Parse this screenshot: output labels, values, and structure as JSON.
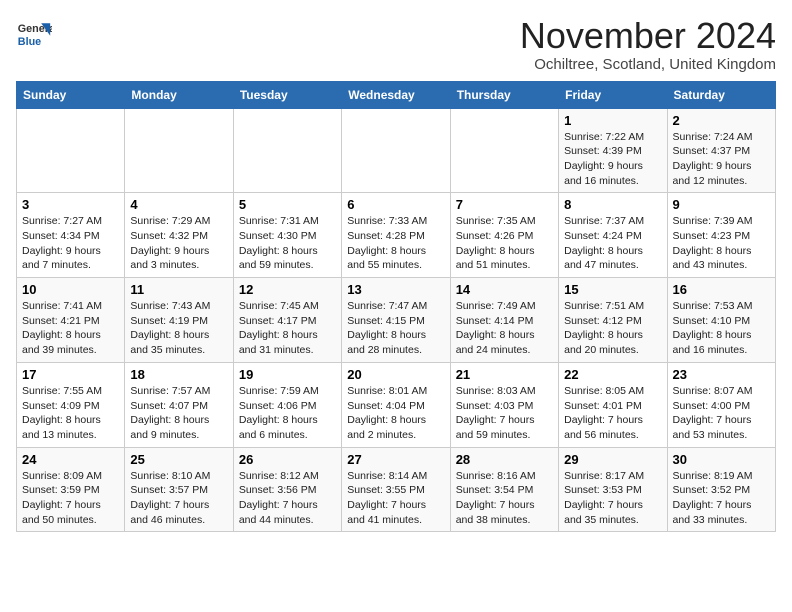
{
  "logo": {
    "text_general": "General",
    "text_blue": "Blue"
  },
  "header": {
    "month_title": "November 2024",
    "location": "Ochiltree, Scotland, United Kingdom"
  },
  "days_of_week": [
    "Sunday",
    "Monday",
    "Tuesday",
    "Wednesday",
    "Thursday",
    "Friday",
    "Saturday"
  ],
  "weeks": [
    [
      {
        "day": "",
        "info": ""
      },
      {
        "day": "",
        "info": ""
      },
      {
        "day": "",
        "info": ""
      },
      {
        "day": "",
        "info": ""
      },
      {
        "day": "",
        "info": ""
      },
      {
        "day": "1",
        "info": "Sunrise: 7:22 AM\nSunset: 4:39 PM\nDaylight: 9 hours and 16 minutes."
      },
      {
        "day": "2",
        "info": "Sunrise: 7:24 AM\nSunset: 4:37 PM\nDaylight: 9 hours and 12 minutes."
      }
    ],
    [
      {
        "day": "3",
        "info": "Sunrise: 7:27 AM\nSunset: 4:34 PM\nDaylight: 9 hours and 7 minutes."
      },
      {
        "day": "4",
        "info": "Sunrise: 7:29 AM\nSunset: 4:32 PM\nDaylight: 9 hours and 3 minutes."
      },
      {
        "day": "5",
        "info": "Sunrise: 7:31 AM\nSunset: 4:30 PM\nDaylight: 8 hours and 59 minutes."
      },
      {
        "day": "6",
        "info": "Sunrise: 7:33 AM\nSunset: 4:28 PM\nDaylight: 8 hours and 55 minutes."
      },
      {
        "day": "7",
        "info": "Sunrise: 7:35 AM\nSunset: 4:26 PM\nDaylight: 8 hours and 51 minutes."
      },
      {
        "day": "8",
        "info": "Sunrise: 7:37 AM\nSunset: 4:24 PM\nDaylight: 8 hours and 47 minutes."
      },
      {
        "day": "9",
        "info": "Sunrise: 7:39 AM\nSunset: 4:23 PM\nDaylight: 8 hours and 43 minutes."
      }
    ],
    [
      {
        "day": "10",
        "info": "Sunrise: 7:41 AM\nSunset: 4:21 PM\nDaylight: 8 hours and 39 minutes."
      },
      {
        "day": "11",
        "info": "Sunrise: 7:43 AM\nSunset: 4:19 PM\nDaylight: 8 hours and 35 minutes."
      },
      {
        "day": "12",
        "info": "Sunrise: 7:45 AM\nSunset: 4:17 PM\nDaylight: 8 hours and 31 minutes."
      },
      {
        "day": "13",
        "info": "Sunrise: 7:47 AM\nSunset: 4:15 PM\nDaylight: 8 hours and 28 minutes."
      },
      {
        "day": "14",
        "info": "Sunrise: 7:49 AM\nSunset: 4:14 PM\nDaylight: 8 hours and 24 minutes."
      },
      {
        "day": "15",
        "info": "Sunrise: 7:51 AM\nSunset: 4:12 PM\nDaylight: 8 hours and 20 minutes."
      },
      {
        "day": "16",
        "info": "Sunrise: 7:53 AM\nSunset: 4:10 PM\nDaylight: 8 hours and 16 minutes."
      }
    ],
    [
      {
        "day": "17",
        "info": "Sunrise: 7:55 AM\nSunset: 4:09 PM\nDaylight: 8 hours and 13 minutes."
      },
      {
        "day": "18",
        "info": "Sunrise: 7:57 AM\nSunset: 4:07 PM\nDaylight: 8 hours and 9 minutes."
      },
      {
        "day": "19",
        "info": "Sunrise: 7:59 AM\nSunset: 4:06 PM\nDaylight: 8 hours and 6 minutes."
      },
      {
        "day": "20",
        "info": "Sunrise: 8:01 AM\nSunset: 4:04 PM\nDaylight: 8 hours and 2 minutes."
      },
      {
        "day": "21",
        "info": "Sunrise: 8:03 AM\nSunset: 4:03 PM\nDaylight: 7 hours and 59 minutes."
      },
      {
        "day": "22",
        "info": "Sunrise: 8:05 AM\nSunset: 4:01 PM\nDaylight: 7 hours and 56 minutes."
      },
      {
        "day": "23",
        "info": "Sunrise: 8:07 AM\nSunset: 4:00 PM\nDaylight: 7 hours and 53 minutes."
      }
    ],
    [
      {
        "day": "24",
        "info": "Sunrise: 8:09 AM\nSunset: 3:59 PM\nDaylight: 7 hours and 50 minutes."
      },
      {
        "day": "25",
        "info": "Sunrise: 8:10 AM\nSunset: 3:57 PM\nDaylight: 7 hours and 46 minutes."
      },
      {
        "day": "26",
        "info": "Sunrise: 8:12 AM\nSunset: 3:56 PM\nDaylight: 7 hours and 44 minutes."
      },
      {
        "day": "27",
        "info": "Sunrise: 8:14 AM\nSunset: 3:55 PM\nDaylight: 7 hours and 41 minutes."
      },
      {
        "day": "28",
        "info": "Sunrise: 8:16 AM\nSunset: 3:54 PM\nDaylight: 7 hours and 38 minutes."
      },
      {
        "day": "29",
        "info": "Sunrise: 8:17 AM\nSunset: 3:53 PM\nDaylight: 7 hours and 35 minutes."
      },
      {
        "day": "30",
        "info": "Sunrise: 8:19 AM\nSunset: 3:52 PM\nDaylight: 7 hours and 33 minutes."
      }
    ]
  ]
}
